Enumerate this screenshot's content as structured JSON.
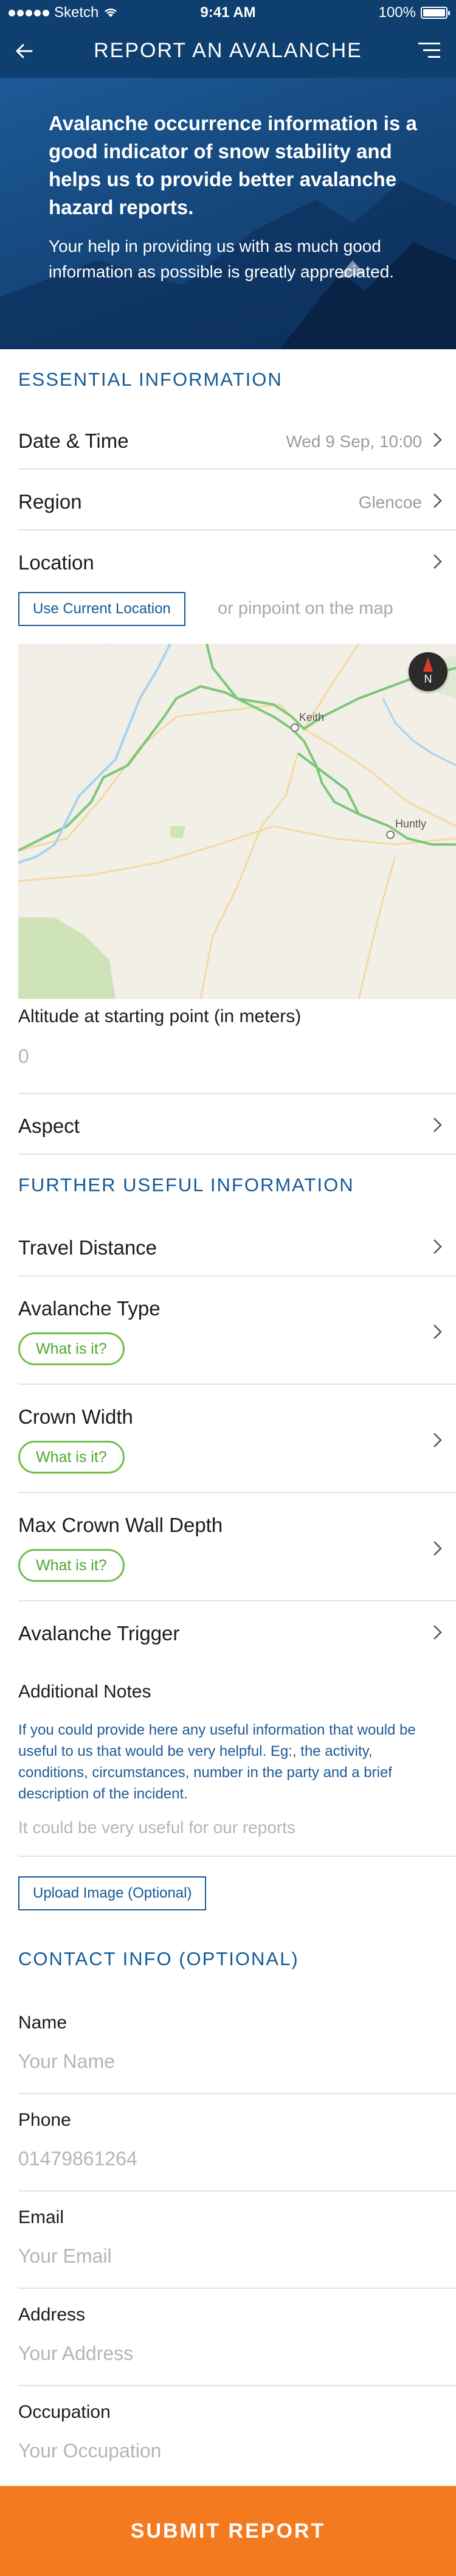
{
  "status_bar": {
    "carrier": "Sketch",
    "time": "9:41 AM",
    "battery": "100%"
  },
  "nav": {
    "title": "REPORT AN AVALANCHE"
  },
  "hero": {
    "heading": "Avalanche occurrence information is a good indicator of snow stability and helps us to provide better avalanche hazard reports.",
    "body": "Your help in providing us with as much good information as possible is greatly appreciated."
  },
  "essential": {
    "title": "ESSENTIAL INFORMATION",
    "date_time": {
      "label": "Date & Time",
      "value": "Wed 9 Sep, 10:00"
    },
    "region": {
      "label": "Region",
      "value": "Glencoe"
    },
    "location": {
      "label": "Location",
      "use_current": "Use Current Location",
      "or_pinpoint": "or pinpoint on the map"
    },
    "map": {
      "places": [
        "Keith",
        "Huntly"
      ],
      "compass": "N"
    },
    "altitude": {
      "label": "Altitude at starting point (in meters)",
      "placeholder": "0"
    },
    "aspect": {
      "label": "Aspect"
    }
  },
  "further": {
    "title": "FURTHER USEFUL INFORMATION",
    "travel_distance": "Travel Distance",
    "avalanche_type": "Avalanche Type",
    "crown_width": "Crown Width",
    "max_crown_wall_depth": "Max Crown Wall Depth",
    "what_is_it": "What is it?",
    "avalanche_trigger": "Avalanche Trigger",
    "notes": {
      "label": "Additional Notes",
      "help": "If you could provide here any useful information that would be useful to us that would be very helpful. Eg:, the activity, conditions, circumstances, number in the party and a brief description of the incident.",
      "placeholder": "It could be very useful for our reports"
    },
    "upload": "Upload Image (Optional)"
  },
  "contact": {
    "title": "CONTACT INFO (OPTIONAL)",
    "name": {
      "label": "Name",
      "placeholder": "Your Name"
    },
    "phone": {
      "label": "Phone",
      "placeholder": "01479861264"
    },
    "email": {
      "label": "Email",
      "placeholder": "Your Email"
    },
    "address": {
      "label": "Address",
      "placeholder": "Your Address"
    },
    "occupation": {
      "label": "Occupation",
      "placeholder": "Your Occupation"
    }
  },
  "submit": "SUBMIT REPORT",
  "colors": {
    "brand_blue": "#0f3f6e",
    "accent_blue": "#145a96",
    "green": "#6fbf4a",
    "orange": "#f47a1f"
  }
}
